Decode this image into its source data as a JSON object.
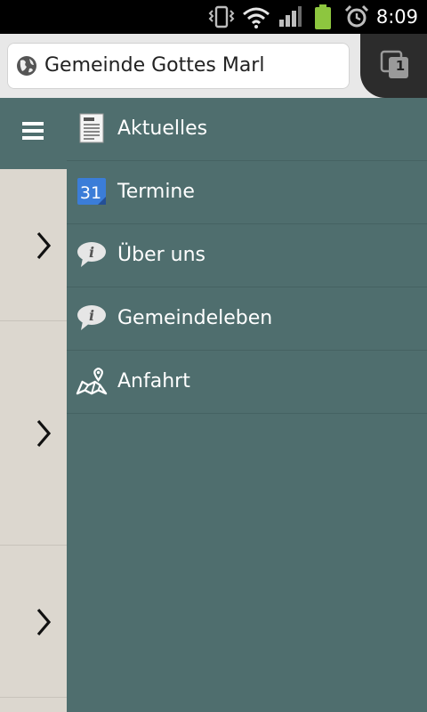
{
  "status_bar": {
    "time": "8:09",
    "icons": [
      "vibrate-icon",
      "wifi-icon",
      "signal-icon",
      "battery-icon",
      "alarm-icon"
    ]
  },
  "browser": {
    "url": "Gemeinde Gottes Marl",
    "tab_count": "1"
  },
  "menu": {
    "items": [
      {
        "label": "Aktuelles",
        "icon": "news-document-icon"
      },
      {
        "label": "Termine",
        "icon": "calendar-icon",
        "icon_text": "31"
      },
      {
        "label": "Über uns",
        "icon": "info-bubble-icon"
      },
      {
        "label": "Gemeindeleben",
        "icon": "info-bubble-icon"
      },
      {
        "label": "Anfahrt",
        "icon": "map-pin-icon"
      }
    ]
  },
  "colors": {
    "drawer_bg": "#4f6e6e",
    "page_bg": "#dcd7cf",
    "status_bar_bg": "#000000",
    "battery_green": "#8dc63f",
    "calendar_blue": "#3b7dd8"
  }
}
